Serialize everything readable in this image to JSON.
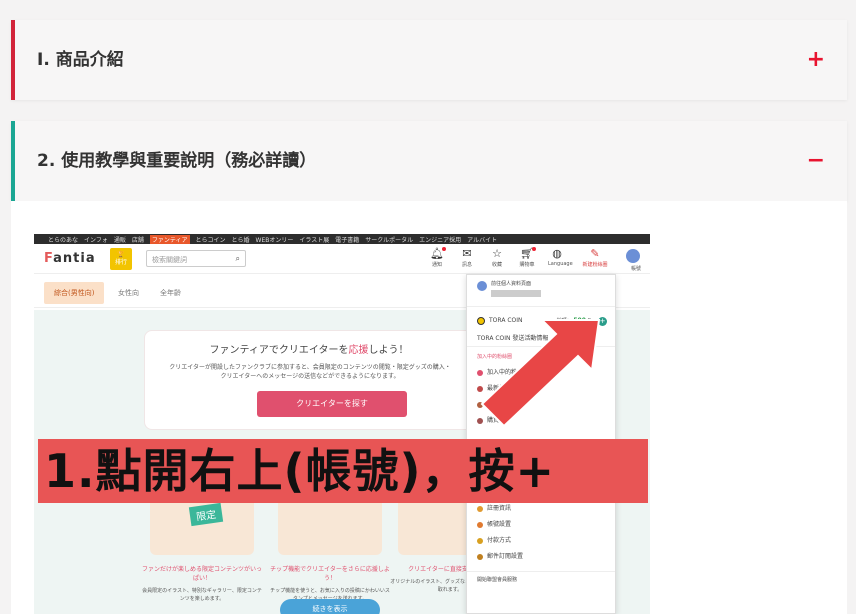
{
  "panels": [
    {
      "title": "I. 商品介紹",
      "toggle": "+"
    },
    {
      "title": "2. 使用教學與重要說明（務必詳讀）",
      "toggle": "−"
    }
  ],
  "shot": {
    "topnav": [
      "とらのあな",
      "インフォ",
      "通販",
      "店舗",
      "ファンティア",
      "とらコイン",
      "とら婚",
      "WEBオンリー",
      "イラスト展",
      "電子書籍",
      "サークルポータル",
      "エンジニア採用",
      "アルバイト"
    ],
    "topnav_active": "ファンティア",
    "logo": "Fantia",
    "trophy_label": "排行",
    "search_placeholder": "檢索關鍵詞",
    "header_icons": [
      {
        "icon": "bell-icon",
        "label": "通知"
      },
      {
        "icon": "mail-icon",
        "label": "訊息"
      },
      {
        "icon": "star-icon",
        "label": "收藏"
      },
      {
        "icon": "cart-icon",
        "label": "購物車"
      },
      {
        "icon": "globe-icon",
        "label": "Language"
      },
      {
        "icon": "pen-icon",
        "label": "新建粉絲圈"
      }
    ],
    "account_label": "帳號",
    "filters": [
      "綜合(男性向)",
      "女性向",
      "全年齡"
    ],
    "hero": {
      "title_a": "ファンティアでクリエイターを",
      "title_hl": "応援",
      "title_b": "しよう！",
      "desc": "クリエイターが開設したファンクラブに参加すると、会員限定のコンテンツの閲覧・限定グッズの購入・クリエイターへのメッセージの送信などができるようになります。",
      "button": "クリエイターを探す"
    },
    "features": [
      {
        "title": "ファンだけが楽しめる限定コンテンツがいっぱい！",
        "desc": "会員限定のイラスト、特別なギャラリー、限定コンテンツを楽しめます。",
        "tag": "限定"
      },
      {
        "title": "チップ機能でクリエイターをさらに応援しよう！",
        "desc": "チップ機能を使うと、お気に入りの投稿にかわいいスタンプとメッセージを送れます。"
      },
      {
        "title": "クリエイターに直接支援できる",
        "desc": "オリジナルのイラスト、グッズなどのリターンを受け取れます。"
      }
    ],
    "more_button": "続きを表示",
    "dropdown": {
      "profile_label": "前往個人資料頁面",
      "coin_label": "TORA COIN",
      "balance_label": "餘額：",
      "balance_value": "500",
      "balance_unit": "C",
      "coin_link": "TORA COIN 發送活動情報",
      "section_label": "加入中的粉絲圈",
      "items_top": [
        "加入中的粉絲圈",
        "最新作品",
        "購買",
        "購買"
      ],
      "items_bottom": [
        "註冊資訊",
        "帳號設置",
        "付款方式",
        "郵件訂閱設置"
      ],
      "last": "開始聯盟會員服務"
    },
    "overlay_text": "1.點開右上(帳號)，按+"
  },
  "colors": {
    "panel1_accent": "#d2243a",
    "panel2_accent": "#1aa693",
    "toggle": "#e8132f",
    "banner": "#e85555",
    "arrow": "#e84646"
  }
}
